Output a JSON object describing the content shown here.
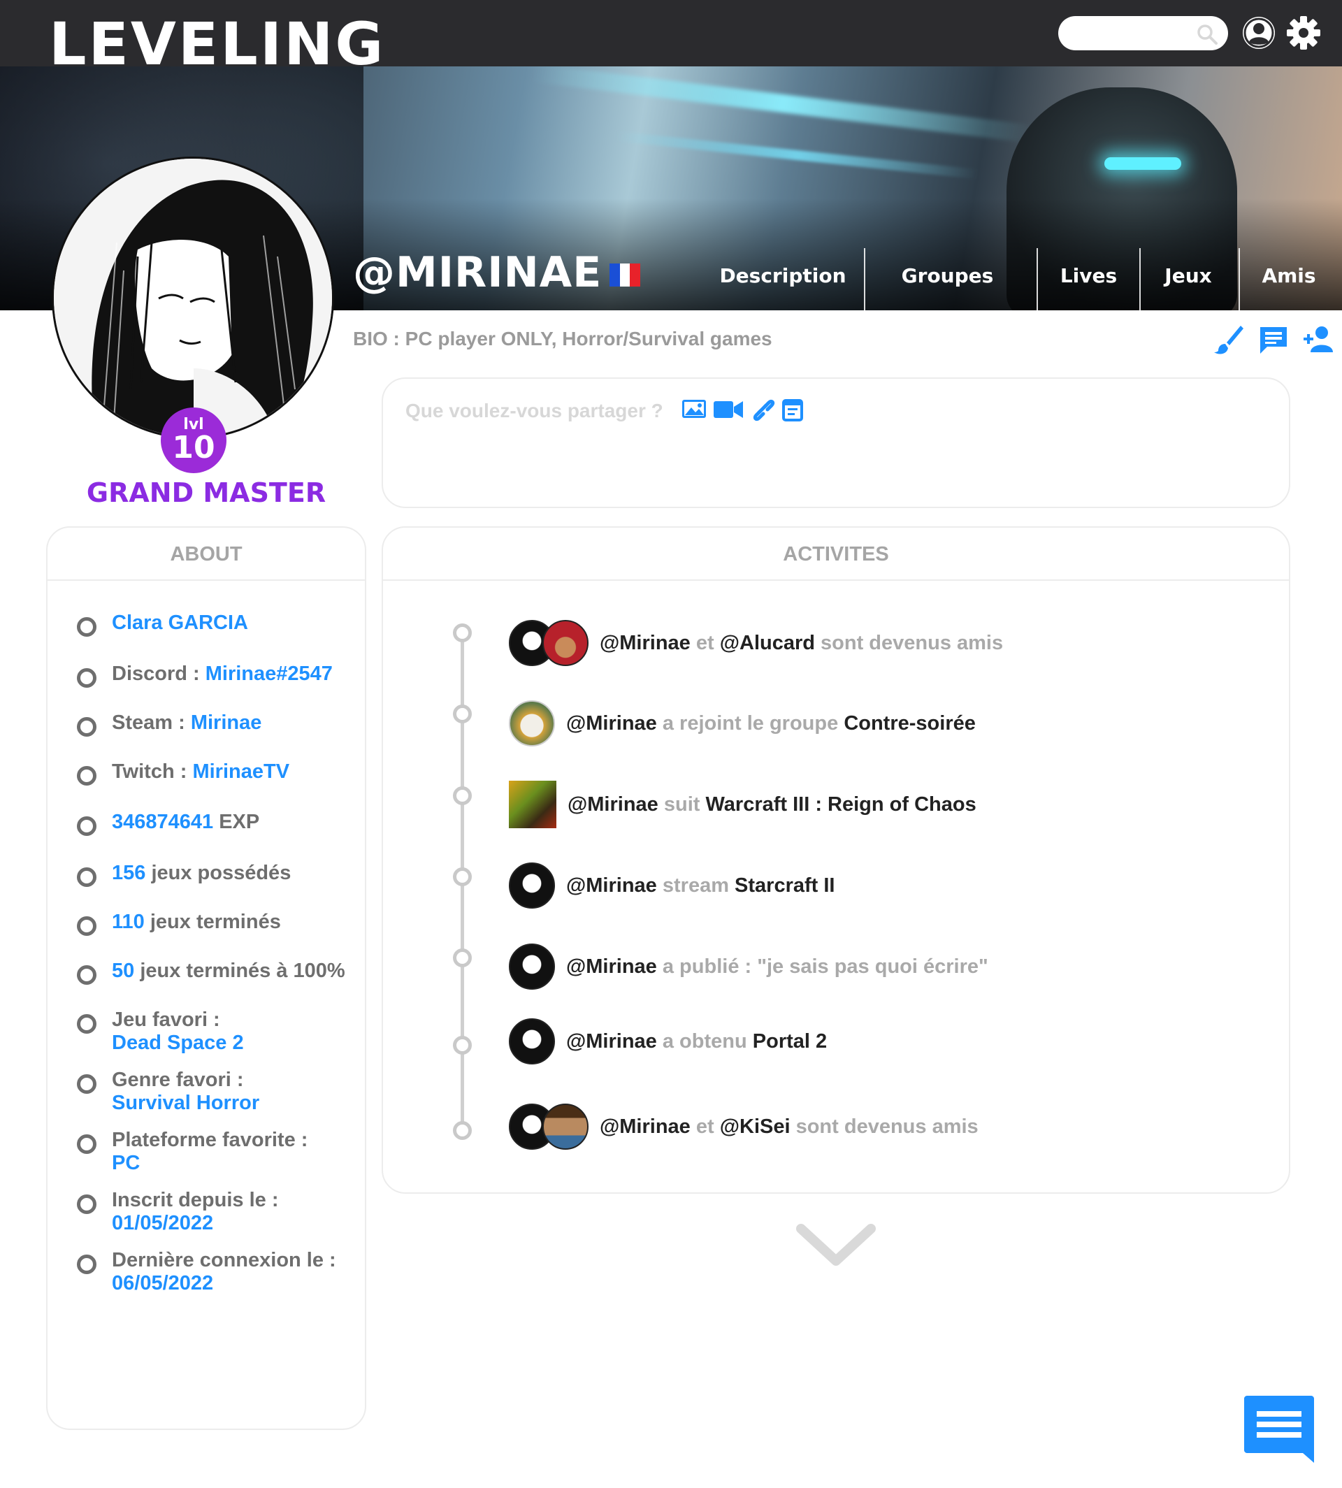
{
  "app": {
    "logo": "LEVELING"
  },
  "search": {
    "placeholder": "",
    "value": ""
  },
  "icons": {
    "search": "search-icon",
    "account": "account-icon",
    "settings": "gear-icon",
    "brand": "#1e90ff",
    "rank": "#8b2be2"
  },
  "profile": {
    "username": "@MIRINAE",
    "country_flag": "france-flag",
    "level_prefix": "lvl",
    "level": "10",
    "rank": "GRAND MASTER",
    "bio": "BIO : PC player ONLY, Horror/Survival games"
  },
  "tabs": [
    "Description",
    "Groupes",
    "Lives",
    "Jeux",
    "Amis"
  ],
  "composer": {
    "placeholder": "Que voulez-vous partager ?"
  },
  "about": {
    "title": "ABOUT",
    "items": [
      {
        "label": "",
        "value": "Clara GARCIA"
      },
      {
        "label": "Discord : ",
        "value": "Mirinae#2547"
      },
      {
        "label": "Steam : ",
        "value": "Mirinae"
      },
      {
        "label": "Twitch : ",
        "value": "MirinaeTV"
      },
      {
        "value": "346874641",
        "suffix": " EXP"
      },
      {
        "value": "156",
        "suffix": " jeux possédés"
      },
      {
        "value": "110",
        "suffix": " jeux terminés"
      },
      {
        "value": "50",
        "suffix": " jeux terminés à 100%"
      },
      {
        "label": "Jeu favori :",
        "value": "Dead Space 2"
      },
      {
        "label": "Genre favori :",
        "value": "Survival Horror"
      },
      {
        "label": "Plateforme favorite :",
        "value": "PC"
      },
      {
        "label": "Inscrit depuis le :",
        "value": "01/05/2022"
      },
      {
        "label": "Dernière connexion le :",
        "value": "06/05/2022"
      }
    ]
  },
  "activity": {
    "title": "ACTIVITES",
    "items": [
      {
        "a": "@Mirinae",
        "b": " et ",
        "c": "@Alucard",
        "d": " sont devenus amis"
      },
      {
        "a": "@Mirinae",
        "b": " a rejoint le groupe ",
        "c": "Contre-soirée",
        "d": ""
      },
      {
        "a": "@Mirinae",
        "b": " suit ",
        "c": "Warcraft III : Reign of Chaos",
        "d": ""
      },
      {
        "a": "@Mirinae",
        "b": " stream ",
        "c": "Starcraft II",
        "d": ""
      },
      {
        "a": "@Mirinae",
        "b": " a publié : \"je sais pas quoi écrire\"",
        "c": "",
        "d": ""
      },
      {
        "a": "@Mirinae",
        "b": " a obtenu ",
        "c": "Portal 2",
        "d": ""
      },
      {
        "a": "@Mirinae",
        "b": " et ",
        "c": "@KiSei",
        "d": " sont devenus amis"
      }
    ]
  }
}
